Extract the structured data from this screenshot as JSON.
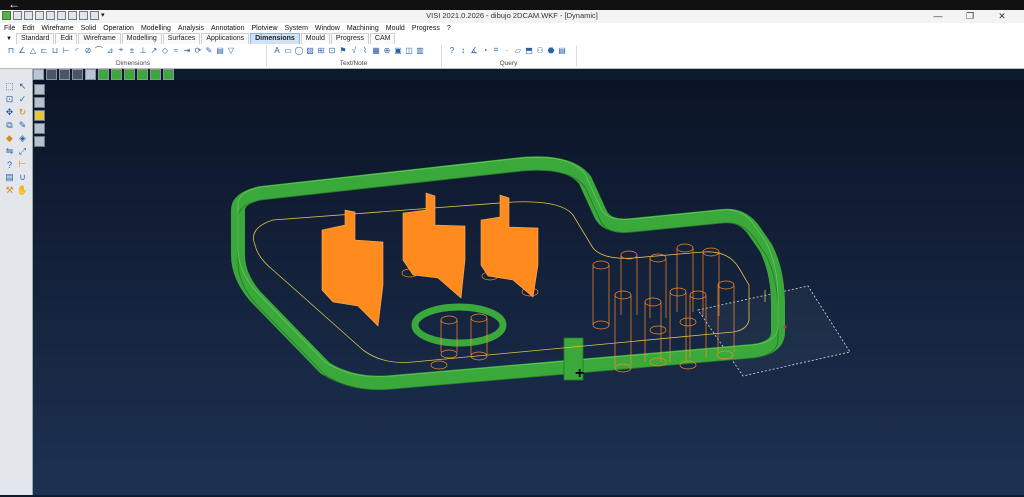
{
  "window": {
    "title": "VISI 2021.0.2026 - dibujo 2DCAM.WKF - [Dynamic]",
    "controls": [
      "—",
      "❐",
      "✕"
    ]
  },
  "menu": [
    "File",
    "Edit",
    "Wireframe",
    "Solid",
    "Operation",
    "Modelling",
    "Analysis",
    "Annotation",
    "Plotview",
    "System",
    "Window",
    "Machining",
    "Mould",
    "Progress",
    "?"
  ],
  "tabs": [
    "Standard",
    "Edit",
    "Wireframe",
    "Modelling",
    "Surfaces",
    "Applications",
    "Dimensions",
    "Mould",
    "Progress",
    "CAM"
  ],
  "active_tab": "Dimensions",
  "ribbon_groups": [
    "Dimensions",
    "Text/Note",
    "Query"
  ],
  "icons": {
    "back": "back-arrow-icon",
    "cursor": "crosshair-cursor-icon"
  },
  "colors": {
    "viewport_top": "#0b1426",
    "viewport_bottom": "#1d3152",
    "toolpath_green": "#3aa83a",
    "part_orange": "#ff8a1e",
    "contour_yellow": "#e0c24a",
    "plane_white": "#d8dde6"
  }
}
